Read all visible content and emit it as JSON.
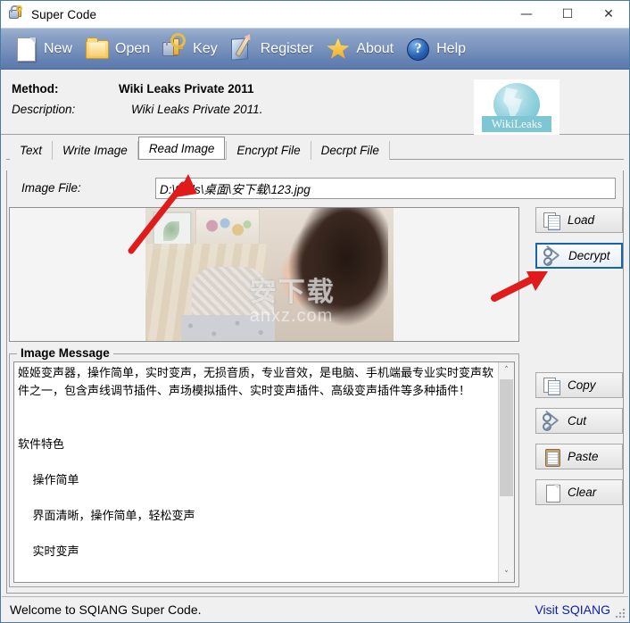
{
  "window": {
    "title": "Super Code",
    "title_icon": "lock-key-icon",
    "controls": {
      "minimize": "—",
      "maximize": "☐",
      "close": "✕"
    }
  },
  "toolbar": {
    "items": [
      {
        "label": "New",
        "icon": "new-document-icon"
      },
      {
        "label": "Open",
        "icon": "open-folder-icon"
      },
      {
        "label": "Key",
        "icon": "lock-key-icon"
      },
      {
        "label": "Register",
        "icon": "register-pencil-icon"
      },
      {
        "label": "About",
        "icon": "star-icon"
      },
      {
        "label": "Help",
        "icon": "question-mark-icon"
      }
    ]
  },
  "method_panel": {
    "method_label": "Method:",
    "method_value": "Wiki Leaks Private 2011",
    "description_label": "Description:",
    "description_value": "Wiki Leaks Private 2011.",
    "logo_text": "WikiLeaks"
  },
  "tabs": {
    "items": [
      {
        "label": "Text",
        "active": false
      },
      {
        "label": "Write Image",
        "active": false
      },
      {
        "label": "Read Image",
        "active": true
      },
      {
        "label": "Encrypt File",
        "active": false
      },
      {
        "label": "Decrpt File",
        "active": false
      }
    ]
  },
  "read_image": {
    "file_label": "Image File:",
    "file_value": "D:\\tools\\桌面\\安下载\\123.jpg",
    "preview_watermark": "安下载",
    "preview_watermark_sub": "anxz.com",
    "buttons": [
      {
        "label": "Load",
        "icon": "copy-pages-icon",
        "selected": false
      },
      {
        "label": "Decrypt",
        "icon": "scissors-icon",
        "selected": true
      }
    ]
  },
  "image_message": {
    "title": "Image Message",
    "text": "姬姬变声器，操作简单，实时变声，无损音质，专业音效，是电脑、手机端最专业实时变声软件之一，包含声线调节插件、声场模拟插件、实时变声插件、高级变声插件等多种插件！\n\n\n软件特色\n\n    操作简单\n\n    界面清晰，操作简单，轻松变声\n\n    实时变声",
    "scrollbar": {
      "up_arrow": "˄",
      "down_arrow": "˅"
    },
    "buttons": [
      {
        "label": "Copy",
        "icon": "copy-pages-icon"
      },
      {
        "label": "Cut",
        "icon": "scissors-icon"
      },
      {
        "label": "Paste",
        "icon": "clipboard-icon"
      },
      {
        "label": "Clear",
        "icon": "blank-page-icon"
      }
    ]
  },
  "statusbar": {
    "message": "Welcome to SQIANG Super Code.",
    "link": "Visit SQIANG"
  },
  "annotations": {
    "arrow_color": "#e01b1b",
    "arrow_read_image": "points-to-read-image-tab",
    "arrow_decrypt": "points-to-decrypt-button"
  }
}
